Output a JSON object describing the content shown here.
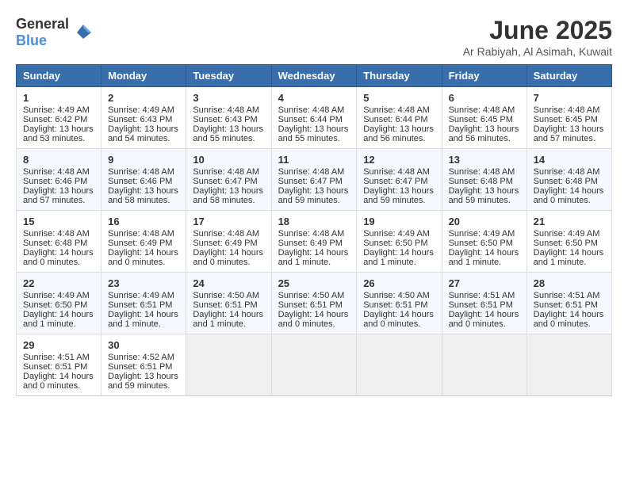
{
  "logo": {
    "general": "General",
    "blue": "Blue"
  },
  "header": {
    "month": "June 2025",
    "location": "Ar Rabiyah, Al Asimah, Kuwait"
  },
  "days": [
    "Sunday",
    "Monday",
    "Tuesday",
    "Wednesday",
    "Thursday",
    "Friday",
    "Saturday"
  ],
  "weeks": [
    [
      {
        "day": "1",
        "sunrise": "Sunrise: 4:49 AM",
        "sunset": "Sunset: 6:42 PM",
        "daylight": "Daylight: 13 hours and 53 minutes."
      },
      {
        "day": "2",
        "sunrise": "Sunrise: 4:49 AM",
        "sunset": "Sunset: 6:43 PM",
        "daylight": "Daylight: 13 hours and 54 minutes."
      },
      {
        "day": "3",
        "sunrise": "Sunrise: 4:48 AM",
        "sunset": "Sunset: 6:43 PM",
        "daylight": "Daylight: 13 hours and 55 minutes."
      },
      {
        "day": "4",
        "sunrise": "Sunrise: 4:48 AM",
        "sunset": "Sunset: 6:44 PM",
        "daylight": "Daylight: 13 hours and 55 minutes."
      },
      {
        "day": "5",
        "sunrise": "Sunrise: 4:48 AM",
        "sunset": "Sunset: 6:44 PM",
        "daylight": "Daylight: 13 hours and 56 minutes."
      },
      {
        "day": "6",
        "sunrise": "Sunrise: 4:48 AM",
        "sunset": "Sunset: 6:45 PM",
        "daylight": "Daylight: 13 hours and 56 minutes."
      },
      {
        "day": "7",
        "sunrise": "Sunrise: 4:48 AM",
        "sunset": "Sunset: 6:45 PM",
        "daylight": "Daylight: 13 hours and 57 minutes."
      }
    ],
    [
      {
        "day": "8",
        "sunrise": "Sunrise: 4:48 AM",
        "sunset": "Sunset: 6:46 PM",
        "daylight": "Daylight: 13 hours and 57 minutes."
      },
      {
        "day": "9",
        "sunrise": "Sunrise: 4:48 AM",
        "sunset": "Sunset: 6:46 PM",
        "daylight": "Daylight: 13 hours and 58 minutes."
      },
      {
        "day": "10",
        "sunrise": "Sunrise: 4:48 AM",
        "sunset": "Sunset: 6:47 PM",
        "daylight": "Daylight: 13 hours and 58 minutes."
      },
      {
        "day": "11",
        "sunrise": "Sunrise: 4:48 AM",
        "sunset": "Sunset: 6:47 PM",
        "daylight": "Daylight: 13 hours and 59 minutes."
      },
      {
        "day": "12",
        "sunrise": "Sunrise: 4:48 AM",
        "sunset": "Sunset: 6:47 PM",
        "daylight": "Daylight: 13 hours and 59 minutes."
      },
      {
        "day": "13",
        "sunrise": "Sunrise: 4:48 AM",
        "sunset": "Sunset: 6:48 PM",
        "daylight": "Daylight: 13 hours and 59 minutes."
      },
      {
        "day": "14",
        "sunrise": "Sunrise: 4:48 AM",
        "sunset": "Sunset: 6:48 PM",
        "daylight": "Daylight: 14 hours and 0 minutes."
      }
    ],
    [
      {
        "day": "15",
        "sunrise": "Sunrise: 4:48 AM",
        "sunset": "Sunset: 6:48 PM",
        "daylight": "Daylight: 14 hours and 0 minutes."
      },
      {
        "day": "16",
        "sunrise": "Sunrise: 4:48 AM",
        "sunset": "Sunset: 6:49 PM",
        "daylight": "Daylight: 14 hours and 0 minutes."
      },
      {
        "day": "17",
        "sunrise": "Sunrise: 4:48 AM",
        "sunset": "Sunset: 6:49 PM",
        "daylight": "Daylight: 14 hours and 0 minutes."
      },
      {
        "day": "18",
        "sunrise": "Sunrise: 4:48 AM",
        "sunset": "Sunset: 6:49 PM",
        "daylight": "Daylight: 14 hours and 1 minute."
      },
      {
        "day": "19",
        "sunrise": "Sunrise: 4:49 AM",
        "sunset": "Sunset: 6:50 PM",
        "daylight": "Daylight: 14 hours and 1 minute."
      },
      {
        "day": "20",
        "sunrise": "Sunrise: 4:49 AM",
        "sunset": "Sunset: 6:50 PM",
        "daylight": "Daylight: 14 hours and 1 minute."
      },
      {
        "day": "21",
        "sunrise": "Sunrise: 4:49 AM",
        "sunset": "Sunset: 6:50 PM",
        "daylight": "Daylight: 14 hours and 1 minute."
      }
    ],
    [
      {
        "day": "22",
        "sunrise": "Sunrise: 4:49 AM",
        "sunset": "Sunset: 6:50 PM",
        "daylight": "Daylight: 14 hours and 1 minute."
      },
      {
        "day": "23",
        "sunrise": "Sunrise: 4:49 AM",
        "sunset": "Sunset: 6:51 PM",
        "daylight": "Daylight: 14 hours and 1 minute."
      },
      {
        "day": "24",
        "sunrise": "Sunrise: 4:50 AM",
        "sunset": "Sunset: 6:51 PM",
        "daylight": "Daylight: 14 hours and 1 minute."
      },
      {
        "day": "25",
        "sunrise": "Sunrise: 4:50 AM",
        "sunset": "Sunset: 6:51 PM",
        "daylight": "Daylight: 14 hours and 0 minutes."
      },
      {
        "day": "26",
        "sunrise": "Sunrise: 4:50 AM",
        "sunset": "Sunset: 6:51 PM",
        "daylight": "Daylight: 14 hours and 0 minutes."
      },
      {
        "day": "27",
        "sunrise": "Sunrise: 4:51 AM",
        "sunset": "Sunset: 6:51 PM",
        "daylight": "Daylight: 14 hours and 0 minutes."
      },
      {
        "day": "28",
        "sunrise": "Sunrise: 4:51 AM",
        "sunset": "Sunset: 6:51 PM",
        "daylight": "Daylight: 14 hours and 0 minutes."
      }
    ],
    [
      {
        "day": "29",
        "sunrise": "Sunrise: 4:51 AM",
        "sunset": "Sunset: 6:51 PM",
        "daylight": "Daylight: 14 hours and 0 minutes."
      },
      {
        "day": "30",
        "sunrise": "Sunrise: 4:52 AM",
        "sunset": "Sunset: 6:51 PM",
        "daylight": "Daylight: 13 hours and 59 minutes."
      },
      null,
      null,
      null,
      null,
      null
    ]
  ]
}
